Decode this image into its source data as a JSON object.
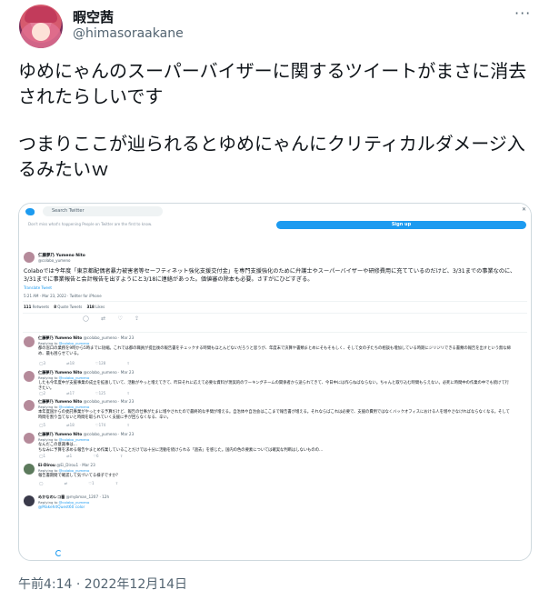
{
  "author": {
    "name": "暇空茜",
    "handle": "@himasoraakane",
    "more_label": "···"
  },
  "tweet": {
    "paragraph1": "ゆめにゃんのスーパーバイザーに関するツイートがまさに消去されたらしいです",
    "paragraph2": "つまりここが辿られるとゆめにゃんにクリティカルダメージ入るみたいｗ",
    "timestamp": "午前4:14 · 2022年12月14日"
  },
  "embedded": {
    "search_placeholder": "Search Twitter",
    "signup_label": "Sign up",
    "x_label": "✕",
    "top_line": "Don't miss what's happening  People on Twitter are the first to know.",
    "main_post": {
      "author_name": "仁藤夢乃 Yumeno Nito",
      "author_handle": "@colabo_yumeno",
      "text": "Colaboでは今年度「東京都配偶者暴力被害者等セーフティネット強化支援交付金」を専門支援強化のために弁護士やスーパーバイザーや研修費用に充てているのだけど、3/31までの事業なのに、3/31までに事業報告と会計報告を出すようにと3/18に連絡があった。価値審の除本も必要。さすがにひどすぎる。",
      "translate": "Translate Tweet",
      "meta": "5:21 AM · Mar 23, 2022 · Twitter for iPhone",
      "retweets": "111",
      "retweets_label": "Retweets",
      "quotes": "8",
      "quotes_label": "Quote Tweets",
      "likes": "318",
      "likes_label": "Likes",
      "actions": "◯       ⇄       ♡       ⇪"
    },
    "replies": [
      {
        "name": "仁藤夢乃 Yumeno Nito",
        "meta": "@colabo_yumeno · Mar 23",
        "replying": "Replying to",
        "replying_to": "@colabo_yumeno",
        "text": "都の窓口の業務を9時から5時までに短縮。これでは都の職員が提出後の報告書をチェックする時間もほとんどないだろうと思うが、年度末で決算や書類まとめにそもそもしく、そして女の子たちの相談も増加している時期にジリジリできる書類の報告を出すという無な締め、最も困らせている。",
        "actions": "◯3 ⇄18 ♡128 ⇪"
      },
      {
        "name": "仁藤夢乃 Yumeno Nito",
        "meta": "@colabo_yumeno · Mar 23",
        "replying": "Replying to",
        "replying_to": "@colabo_yumeno",
        "text": "したも今年度中が支援事業の成立を拡張していて、活動がやっと増えてきて、昨日それに応えて必要な資料が現実的のワーキングチームの関係者から送られてきて、今日中には作らねばならない。ちゃんと取り込む時間もらえない。必死に時間中の作業の中でも続けて行きたい。",
        "actions": "◯2 ⇄17 ♡125 ⇪"
      },
      {
        "name": "仁藤夢乃 Yumeno Nito",
        "meta": "@colabo_yumeno · Mar 23",
        "replying": "Replying to",
        "replying_to": "@colabo_yumeno",
        "text": "本年度国からの委託事業がやっとする予算だけど、報告の仕事がたまに増やされたので最終的な手間が増える。自治体や自治会はここまで報告書が増える。それならばこれは必要で、支援の費用ではなくバックオフィスにおける人を増やさなければならなくなる。そして時間を割り当てないと時間を取られていく支援に手が回らなくなる、辛い。",
        "actions": "◯5 ⇄18 ♡174 ⇪"
      },
      {
        "name": "仁藤夢乃 Yumeno Nito",
        "meta": "@colabo_yumeno · Mar 23",
        "replying": "Replying to",
        "replying_to": "@colabo_yumeno",
        "text": "なんだこの意識事は…\nちなみに予算を求める報告やまとめ作業していることだけでは十分に活動を続けられる「過去」を感じた。国内の色の要素については確実な判断はしないものの…",
        "actions": "◯1 ⇄1 ♡6 ⇪"
      },
      {
        "name": "Ei-Dirou",
        "meta": "@Ei_Dirou1 · Mar 23",
        "replying": "Replying to",
        "replying_to": "@colabo_yumeno",
        "text": "報告書期間で確認して気づいてる様子ですか？",
        "actions": "◯ ⇄ ♡1 ⇪"
      },
      {
        "name": "めかなのレコ番",
        "meta": "@mybman_1207 · 12h",
        "replying": "Replying to",
        "replying_to": "@colabo_yumeno",
        "text": "@MakehitQuest60 color",
        "actions": ""
      }
    ]
  }
}
